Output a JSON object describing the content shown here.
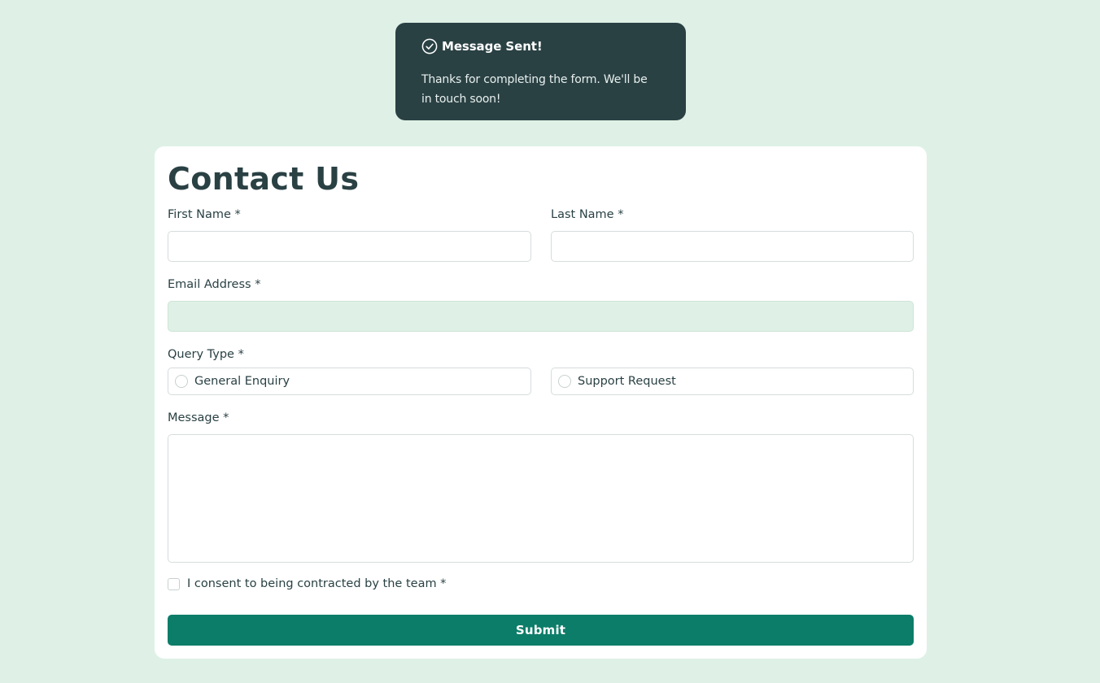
{
  "toast": {
    "icon": "check-circle-icon",
    "title": "Message Sent!",
    "body": "Thanks for completing the form. We'll be in touch soon!"
  },
  "form": {
    "title": "Contact Us",
    "first_name": {
      "label": "First Name *",
      "value": ""
    },
    "last_name": {
      "label": "Last Name *",
      "value": ""
    },
    "email": {
      "label": "Email Address *",
      "value": ""
    },
    "query_type": {
      "label": "Query Type *",
      "options": [
        "General Enquiry",
        "Support Request"
      ],
      "selected": null
    },
    "message": {
      "label": "Message *",
      "value": ""
    },
    "consent": {
      "label": "I consent to being contracted by the team *",
      "checked": false
    },
    "submit_label": "Submit"
  },
  "colors": {
    "background": "#dff1e6",
    "toast": "#2a4144",
    "accent": "#0c7d69",
    "text": "#2a4144"
  }
}
